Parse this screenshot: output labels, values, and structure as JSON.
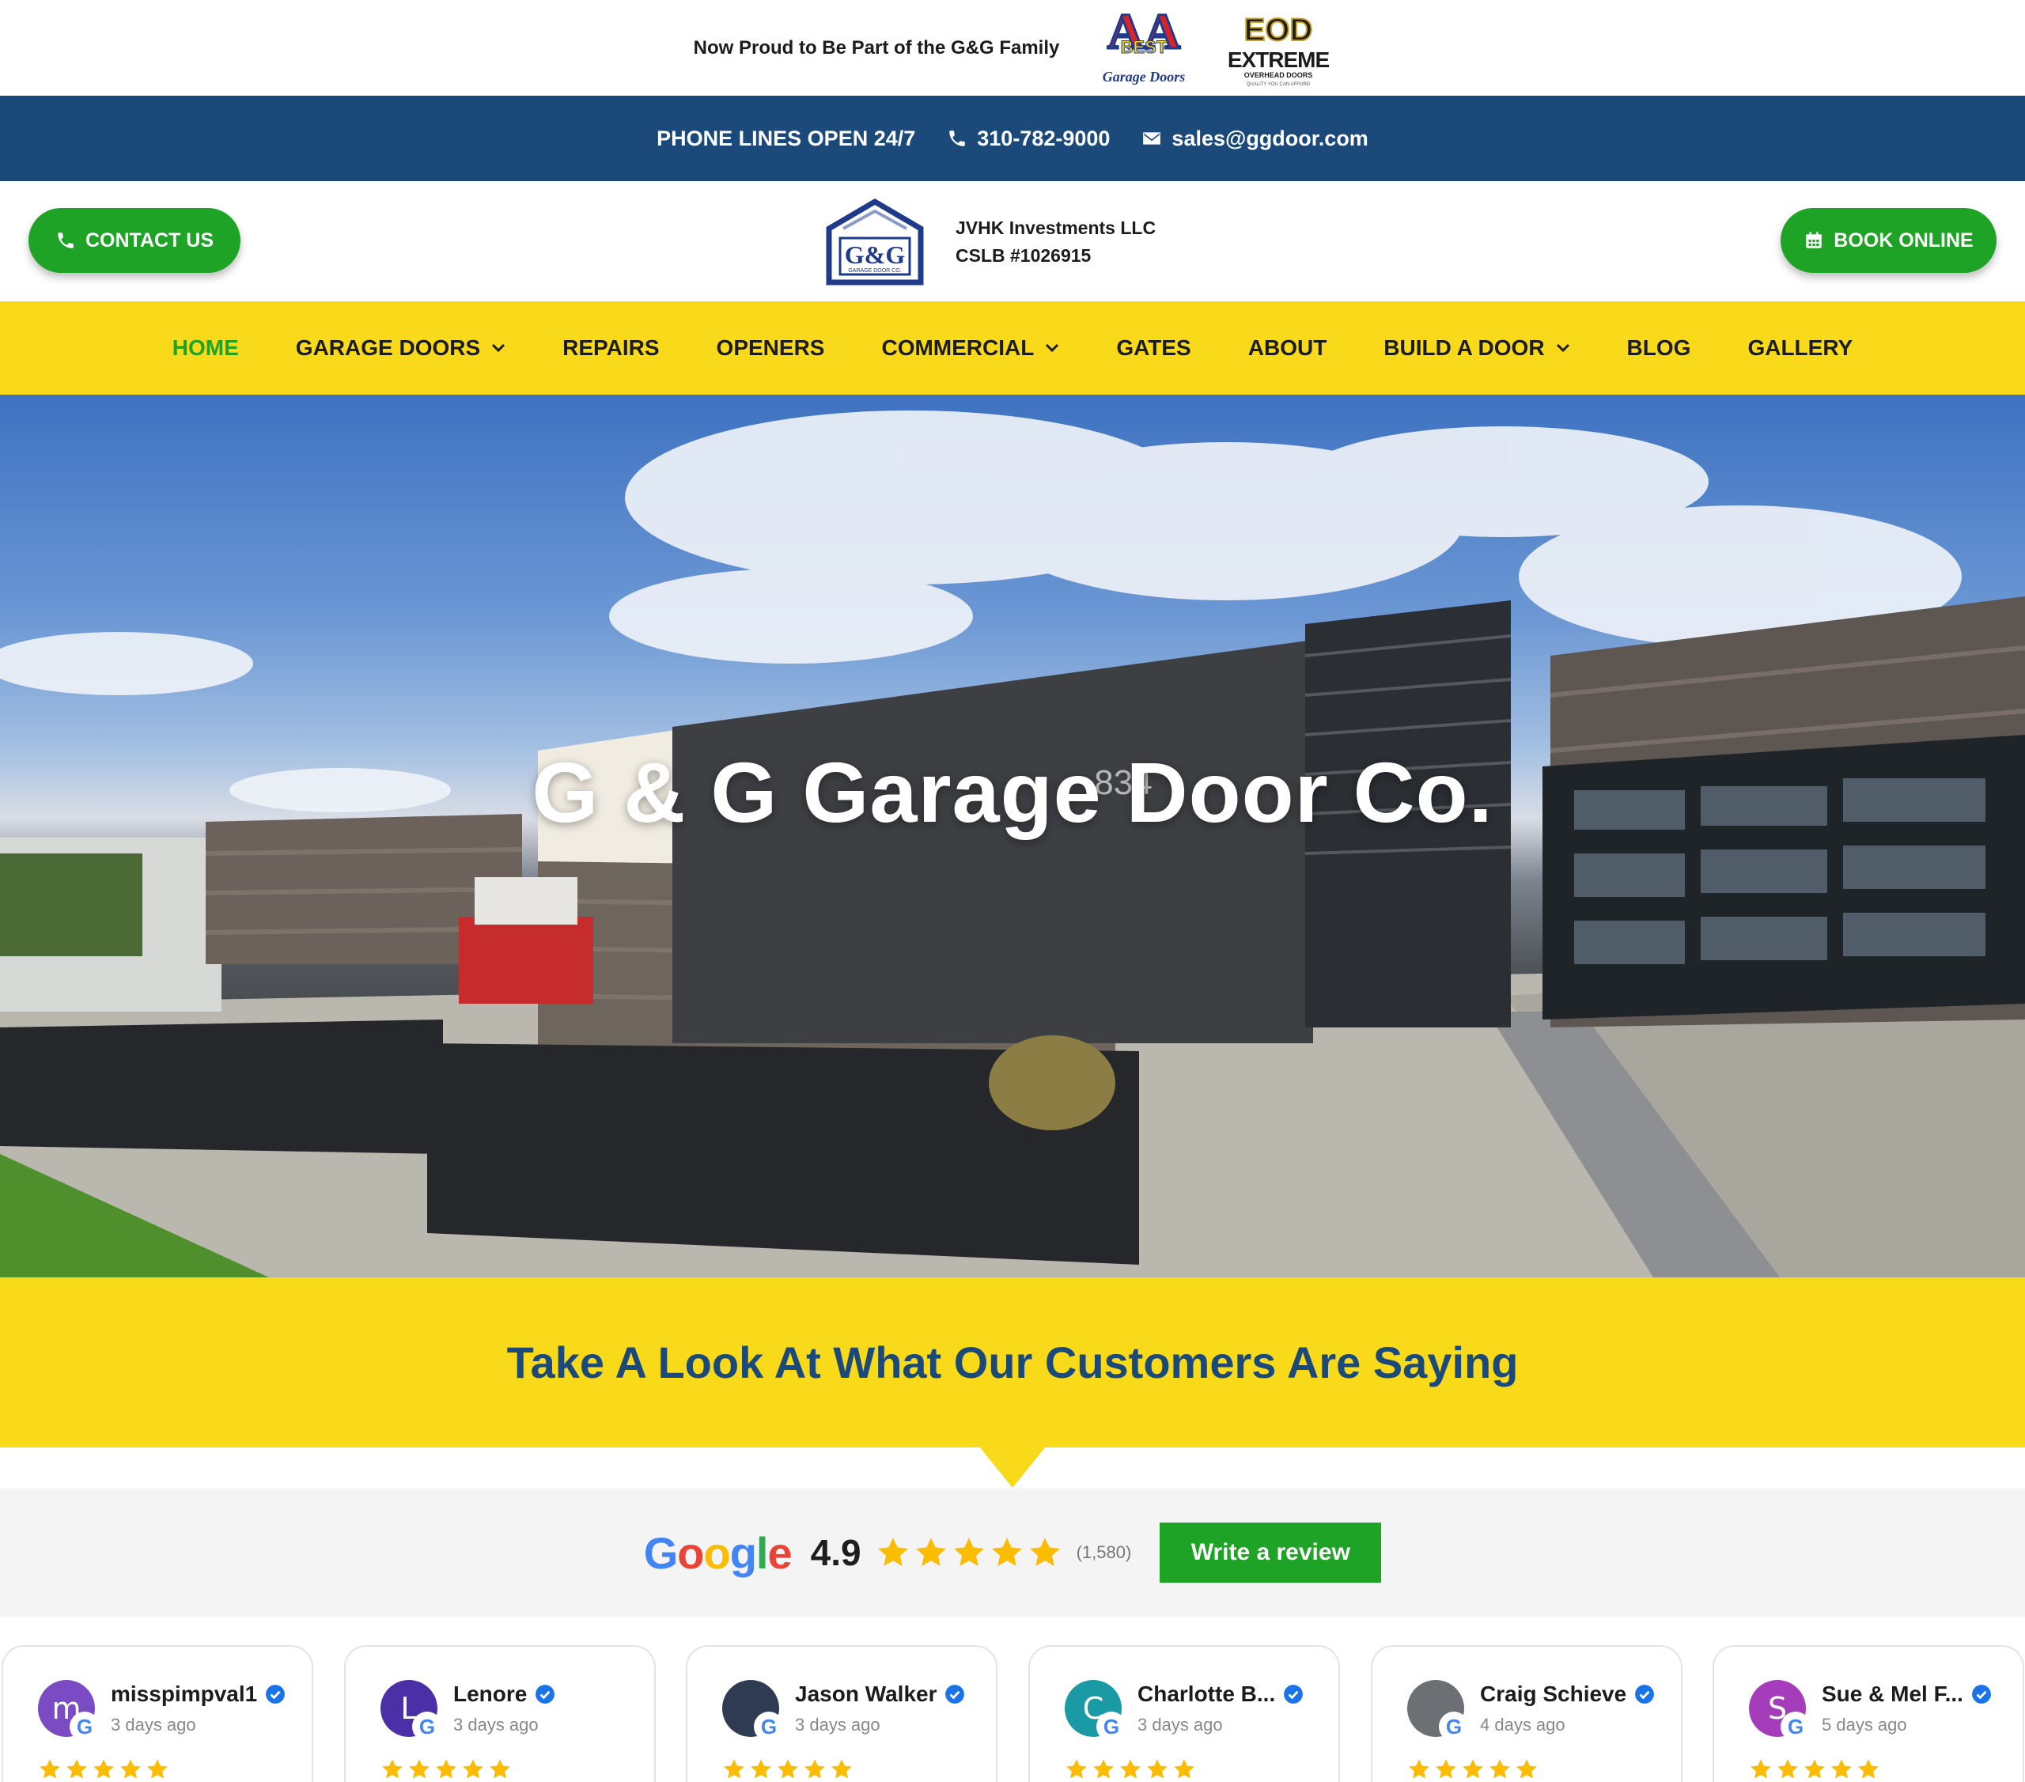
{
  "announcement": {
    "text": "Now Proud to Be Part of the G&G Family",
    "logo_best": {
      "top": "AA",
      "mid": "BEST",
      "sub": "Garage Doors"
    },
    "logo_eod": {
      "top": "EOD",
      "mid": "EXTREME",
      "sub": "OVERHEAD DOORS",
      "tag": "QUALITY YOU CAN AFFORD"
    }
  },
  "contact_strip": {
    "hours": "PHONE LINES OPEN 24/7",
    "phone": "310-782-9000",
    "email": "sales@ggdoor.com"
  },
  "header": {
    "contact_label": "CONTACT US",
    "book_label": "BOOK ONLINE",
    "brand_text": "G&G",
    "brand_sub": "GARAGE DOOR CO.",
    "license_line1": "JVHK Investments LLC",
    "license_line2": "CSLB #1026915"
  },
  "nav": {
    "items": [
      {
        "label": "HOME",
        "active": true,
        "dropdown": false
      },
      {
        "label": "GARAGE DOORS",
        "active": false,
        "dropdown": true
      },
      {
        "label": "REPAIRS",
        "active": false,
        "dropdown": false
      },
      {
        "label": "OPENERS",
        "active": false,
        "dropdown": false
      },
      {
        "label": "COMMERCIAL",
        "active": false,
        "dropdown": true
      },
      {
        "label": "GATES",
        "active": false,
        "dropdown": false
      },
      {
        "label": "ABOUT",
        "active": false,
        "dropdown": false
      },
      {
        "label": "BUILD A DOOR",
        "active": false,
        "dropdown": true
      },
      {
        "label": "BLOG",
        "active": false,
        "dropdown": false
      },
      {
        "label": "GALLERY",
        "active": false,
        "dropdown": false
      }
    ]
  },
  "hero": {
    "title": "G & G Garage Door Co.",
    "house_number": "834"
  },
  "testimonials": {
    "heading": "Take A Look At What Our Customers Are Saying"
  },
  "google_rating": {
    "brand": "Google",
    "rating": "4.9",
    "stars": 5,
    "count": "(1,580)",
    "write_label": "Write a review"
  },
  "reviews": [
    {
      "name": "misspimpval1",
      "ago": "3 days ago",
      "initial": "m",
      "color": "#7b4bc4",
      "stars": 5
    },
    {
      "name": "Lenore",
      "ago": "3 days ago",
      "initial": "L",
      "color": "#4a2fa7",
      "stars": 5
    },
    {
      "name": "Jason Walker",
      "ago": "3 days ago",
      "initial": "",
      "color": "#2f3b52",
      "stars": 5
    },
    {
      "name": "Charlotte B...",
      "ago": "3 days ago",
      "initial": "C",
      "color": "#1a9aa5",
      "stars": 5
    },
    {
      "name": "Craig Schieve",
      "ago": "4 days ago",
      "initial": "",
      "color": "#6c6f73",
      "stars": 5
    },
    {
      "name": "Sue & Mel F...",
      "ago": "5 days ago",
      "initial": "S",
      "color": "#a53dbb",
      "stars": 5
    }
  ],
  "colors": {
    "navy": "#1b4a7a",
    "yellow": "#f8da1b",
    "green": "#1fa326",
    "active_nav": "#21a321",
    "star": "#fbbc04"
  }
}
